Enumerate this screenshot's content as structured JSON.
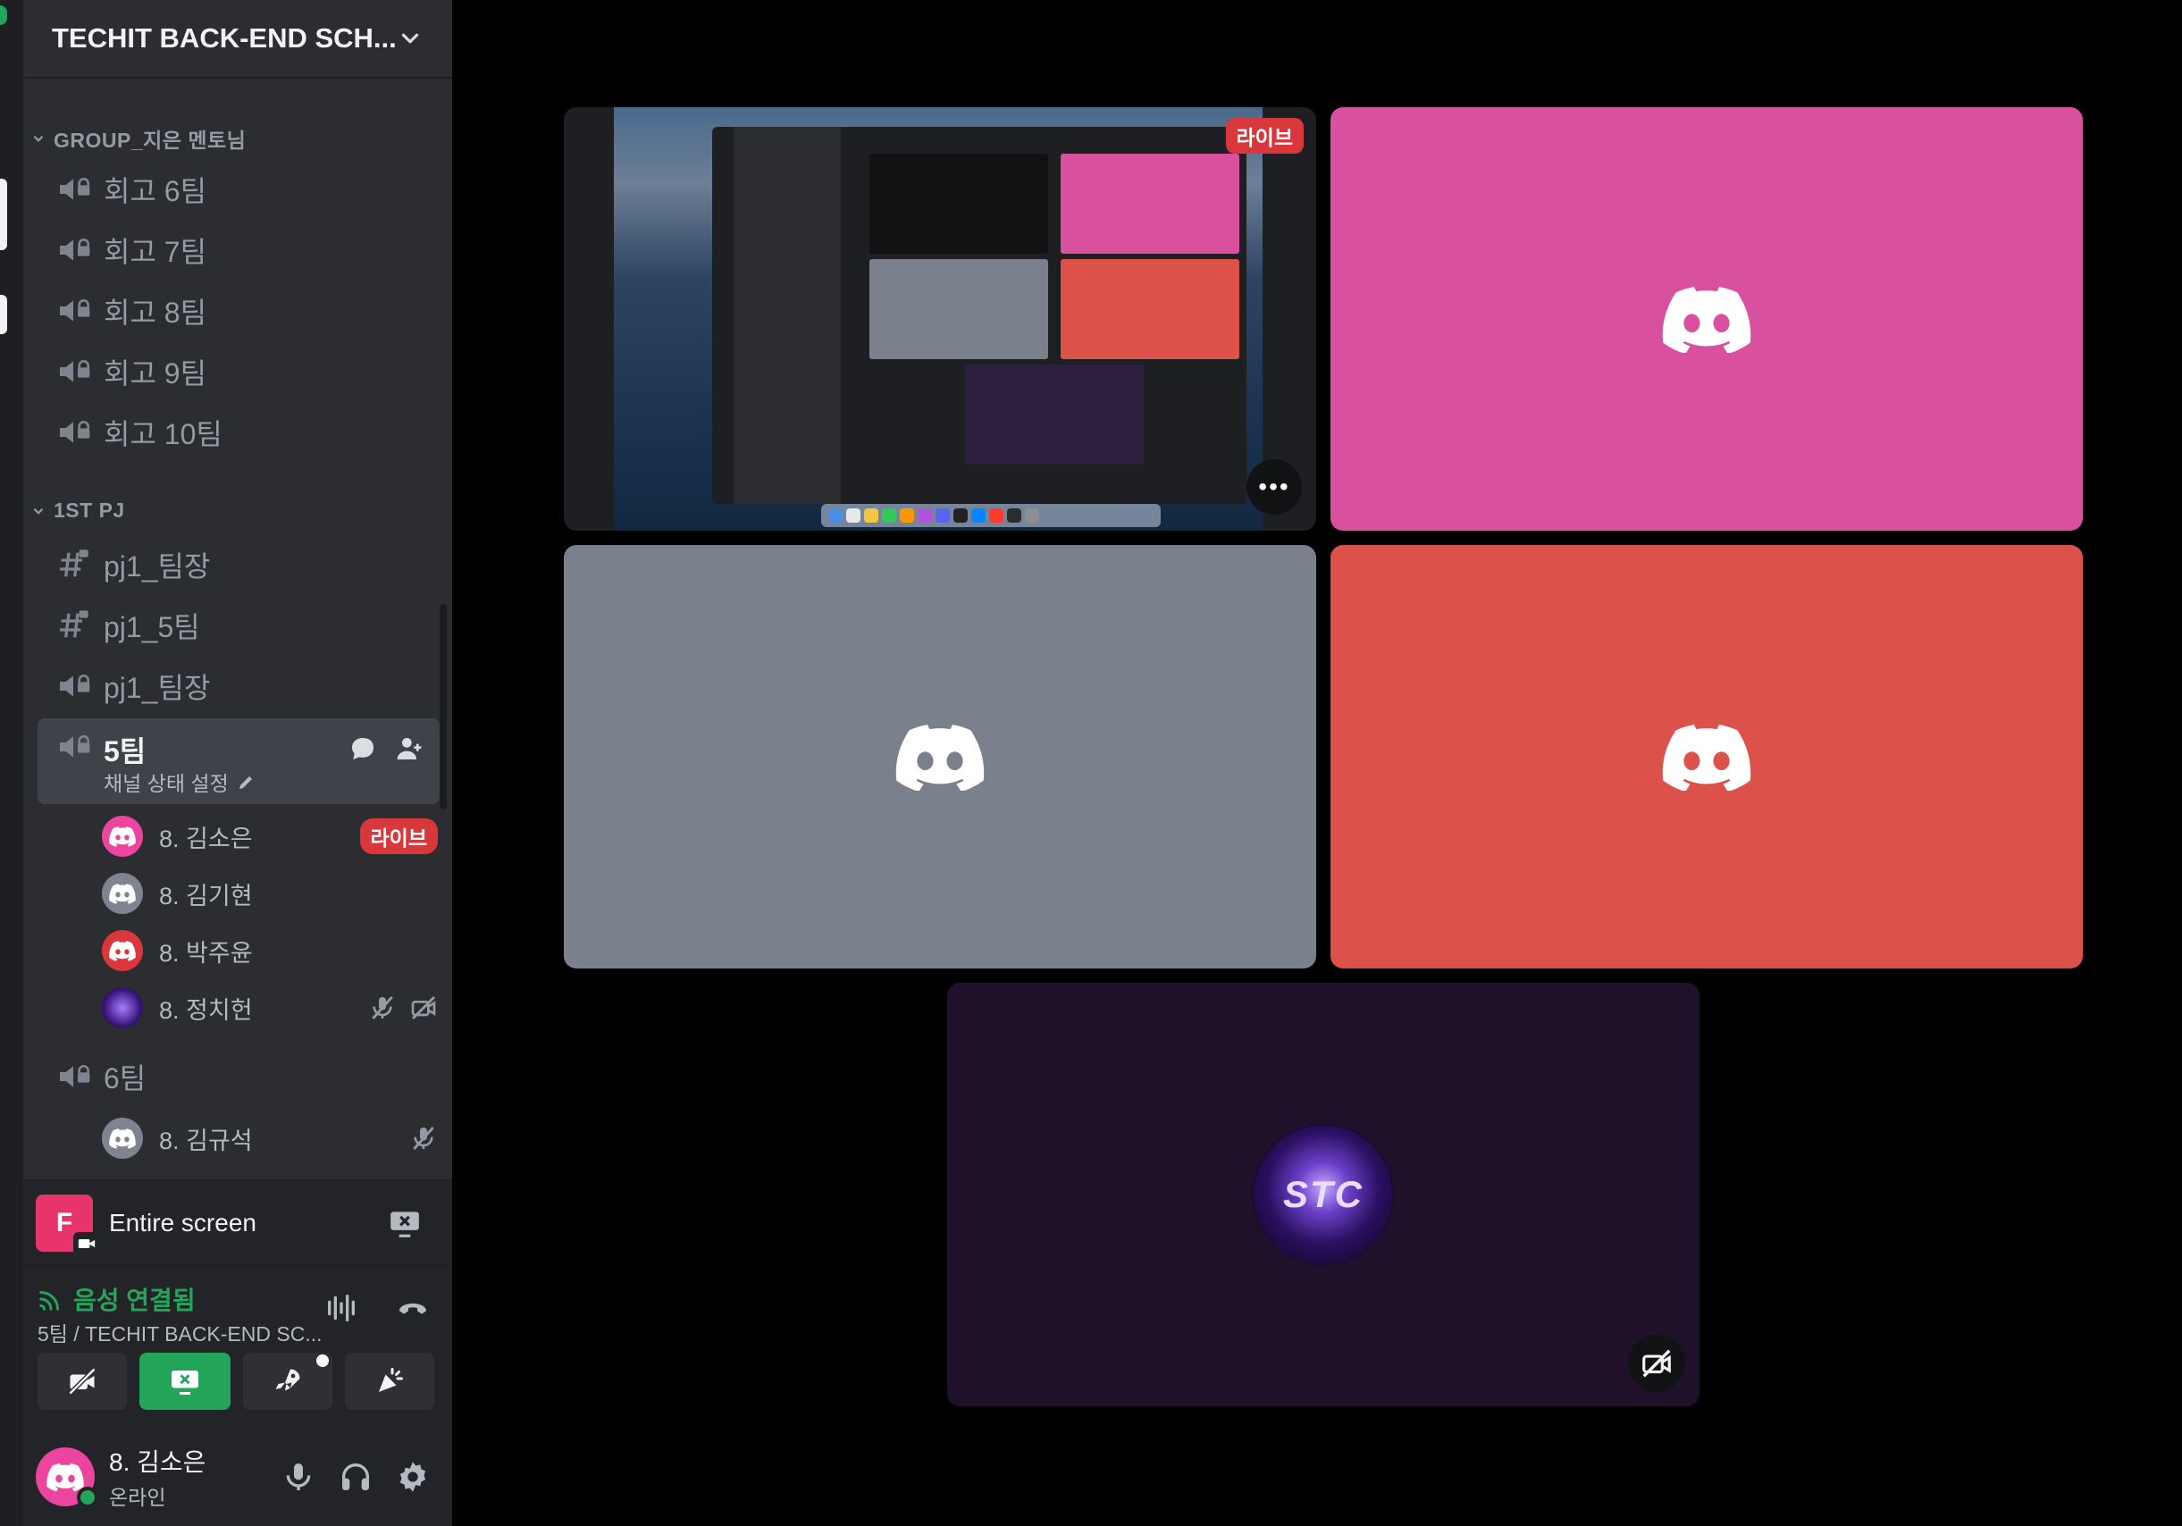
{
  "server": {
    "name": "TECHIT BACK-END SCH..."
  },
  "categories": {
    "group": "GROUP_지은 멘토님",
    "pj": "1ST PJ"
  },
  "group_channels": [
    "회고 6팀",
    "회고 7팀",
    "회고 8팀",
    "회고 9팀",
    "회고 10팀"
  ],
  "pj_channels": [
    {
      "name": "pj1_팀장",
      "type": "text"
    },
    {
      "name": "pj1_5팀",
      "type": "text"
    },
    {
      "name": "pj1_팀장",
      "type": "voice"
    }
  ],
  "active_channel": {
    "name": "5팀",
    "status_placeholder": "채널 상태 설정",
    "members": [
      {
        "name": "8. 김소은",
        "avatar_color": "#eb459f",
        "badge": "라이브"
      },
      {
        "name": "8. 김기현",
        "avatar_color": "#80848e"
      },
      {
        "name": "8. 박주윤",
        "avatar_color": "#da373c"
      },
      {
        "name": "8. 정치헌",
        "avatar_color": "#2a1060",
        "icons": [
          "mic-muted-icon",
          "video-off-icon"
        ]
      }
    ]
  },
  "next_channel": {
    "name": "6팀",
    "members": [
      {
        "name": "8. 김규석",
        "avatar_color": "#80848e",
        "icons": [
          "mic-muted-icon"
        ]
      }
    ]
  },
  "screen_share": {
    "label": "Entire screen",
    "thumb_letter": "F"
  },
  "voice": {
    "status": "음성 연결됨",
    "channel": "5팀 / TECHIT BACK-END SC..."
  },
  "me": {
    "name": "8. 김소은",
    "status": "온라인",
    "avatar_color": "#eb459f"
  },
  "stage": {
    "live_label": "라이브",
    "more_label": "•••"
  },
  "tiles": [
    {
      "id": "screen-share",
      "color": "#1e1f22"
    },
    {
      "id": "kim-soeun",
      "color": "#d9509f"
    },
    {
      "id": "kim-gihyeon",
      "color": "#7a808c"
    },
    {
      "id": "park-juyun",
      "color": "#dc524a"
    },
    {
      "id": "jeong-chiheon",
      "color": "#1e1129",
      "avatar_text": "STC"
    }
  ],
  "colors": {
    "sidebar": "#2b2d31",
    "panel": "#232428",
    "accent_green": "#23a55a",
    "live_red": "#da373c"
  }
}
